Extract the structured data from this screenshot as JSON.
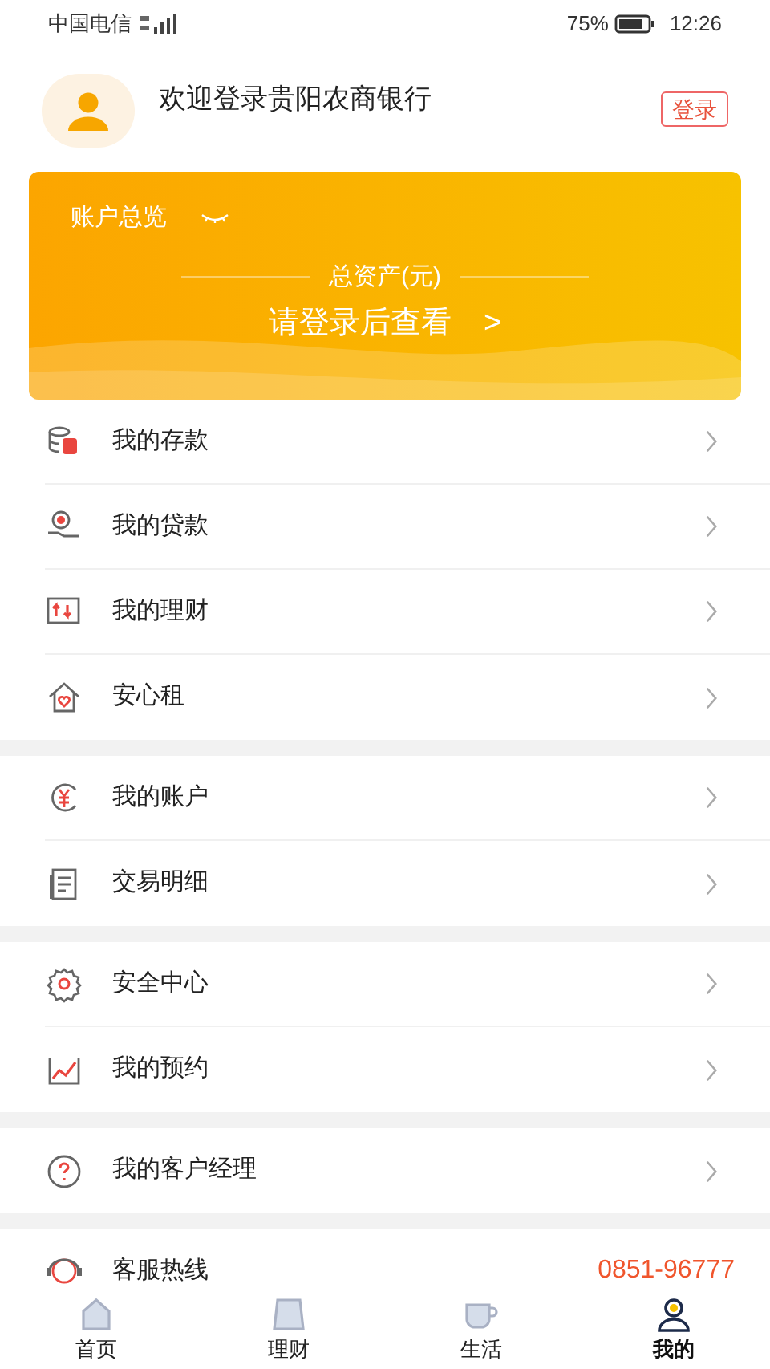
{
  "status_bar": {
    "carrier": "中国电信",
    "battery": "75%",
    "time": "12:26"
  },
  "header": {
    "welcome": "欢迎登录贵阳农商银行",
    "login_button": "登录"
  },
  "account_card": {
    "title": "账户总览",
    "total_label": "总资产(元)",
    "prompt": "请登录后查看",
    "arrow": ">"
  },
  "menu_groups": [
    [
      {
        "label": "我的存款"
      },
      {
        "label": "我的贷款"
      },
      {
        "label": "我的理财"
      },
      {
        "label": "安心租"
      }
    ],
    [
      {
        "label": "我的账户"
      },
      {
        "label": "交易明细"
      }
    ],
    [
      {
        "label": "安全中心"
      },
      {
        "label": "我的预约"
      }
    ],
    [
      {
        "label": "我的客户经理"
      }
    ]
  ],
  "hotline": {
    "label": "客服热线",
    "number": "0851-96777"
  },
  "tabs": [
    {
      "label": "首页",
      "selected": false
    },
    {
      "label": "理财",
      "selected": false
    },
    {
      "label": "生活",
      "selected": false
    },
    {
      "label": "我的",
      "selected": true
    }
  ]
}
